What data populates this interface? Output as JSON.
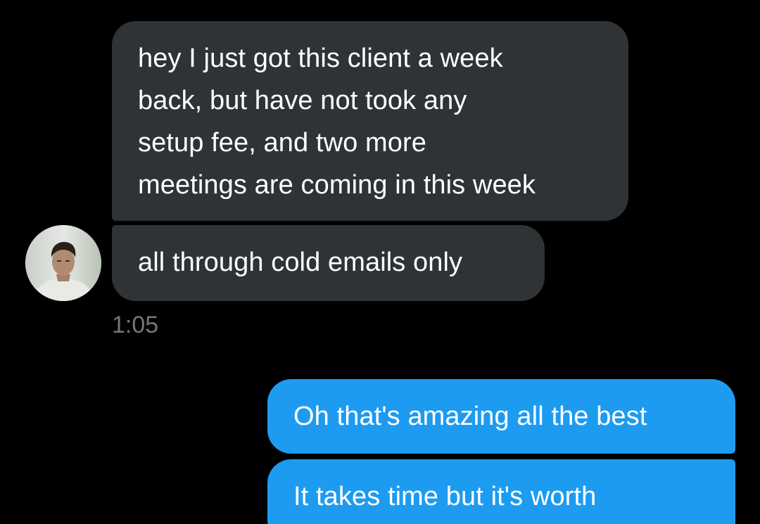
{
  "conversation": {
    "incoming": {
      "message_1_lines": [
        "hey I just got this client a week",
        "back, but have not took any",
        "setup fee, and two more",
        "meetings are coming in this week"
      ],
      "message_2": "all through cold emails only",
      "timestamp": "1:05",
      "avatar_icon": "contact-avatar-photo"
    },
    "outgoing": {
      "message_1": "Oh that's amazing all the best",
      "message_2": "It takes time but it's worth"
    }
  },
  "colors": {
    "background": "#000000",
    "incoming_bubble": "#2f3336",
    "outgoing_bubble": "#1d9bf0",
    "timestamp_text": "#71767b"
  }
}
